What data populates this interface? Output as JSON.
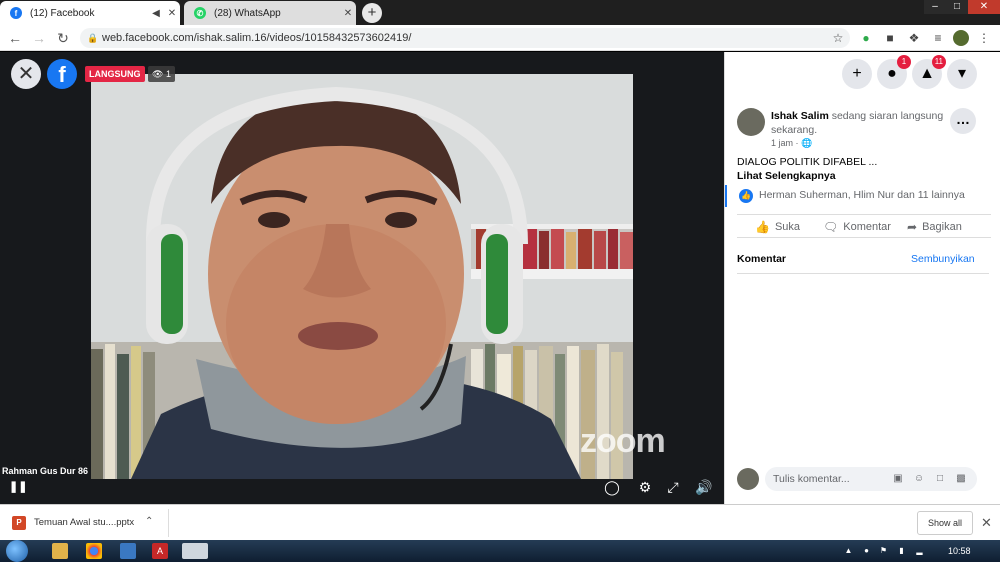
{
  "browser": {
    "tabs": [
      {
        "title": "(12) Facebook",
        "icon": "facebook-icon",
        "active": true
      },
      {
        "title": "(28) WhatsApp",
        "icon": "whatsapp-icon",
        "active": false
      }
    ],
    "url": "web.facebook.com/ishak.salim.16/videos/10158432573602419/"
  },
  "video": {
    "live_label": "LANGSUNG",
    "viewer_count": "1",
    "speaker_name": "Rahman Gus Dur 86",
    "watermark": "zoom"
  },
  "topbar": {
    "messenger_badge": "1",
    "notifications_badge": "11"
  },
  "post": {
    "author": "Ishak Salim",
    "status": "sedang siaran langsung sekarang.",
    "time": "1 jam",
    "text": "DIALOG POLITIK DIFABEL ...",
    "see_more": "Lihat Selengkapnya",
    "reactors": "Herman Suherman, Hlim Nur dan 11 lainnya",
    "actions": {
      "like": "Suka",
      "comment": "Komentar",
      "share": "Bagikan"
    },
    "comments_label": "Komentar",
    "hide_label": "Sembunyikan",
    "comment_placeholder": "Tulis komentar..."
  },
  "download": {
    "file_name": "Temuan Awal stu....pptx",
    "show_all": "Show all"
  },
  "taskbar": {
    "clock": "10:58"
  },
  "colors": {
    "facebook_blue": "#1877f2",
    "live_red": "#e42645"
  }
}
